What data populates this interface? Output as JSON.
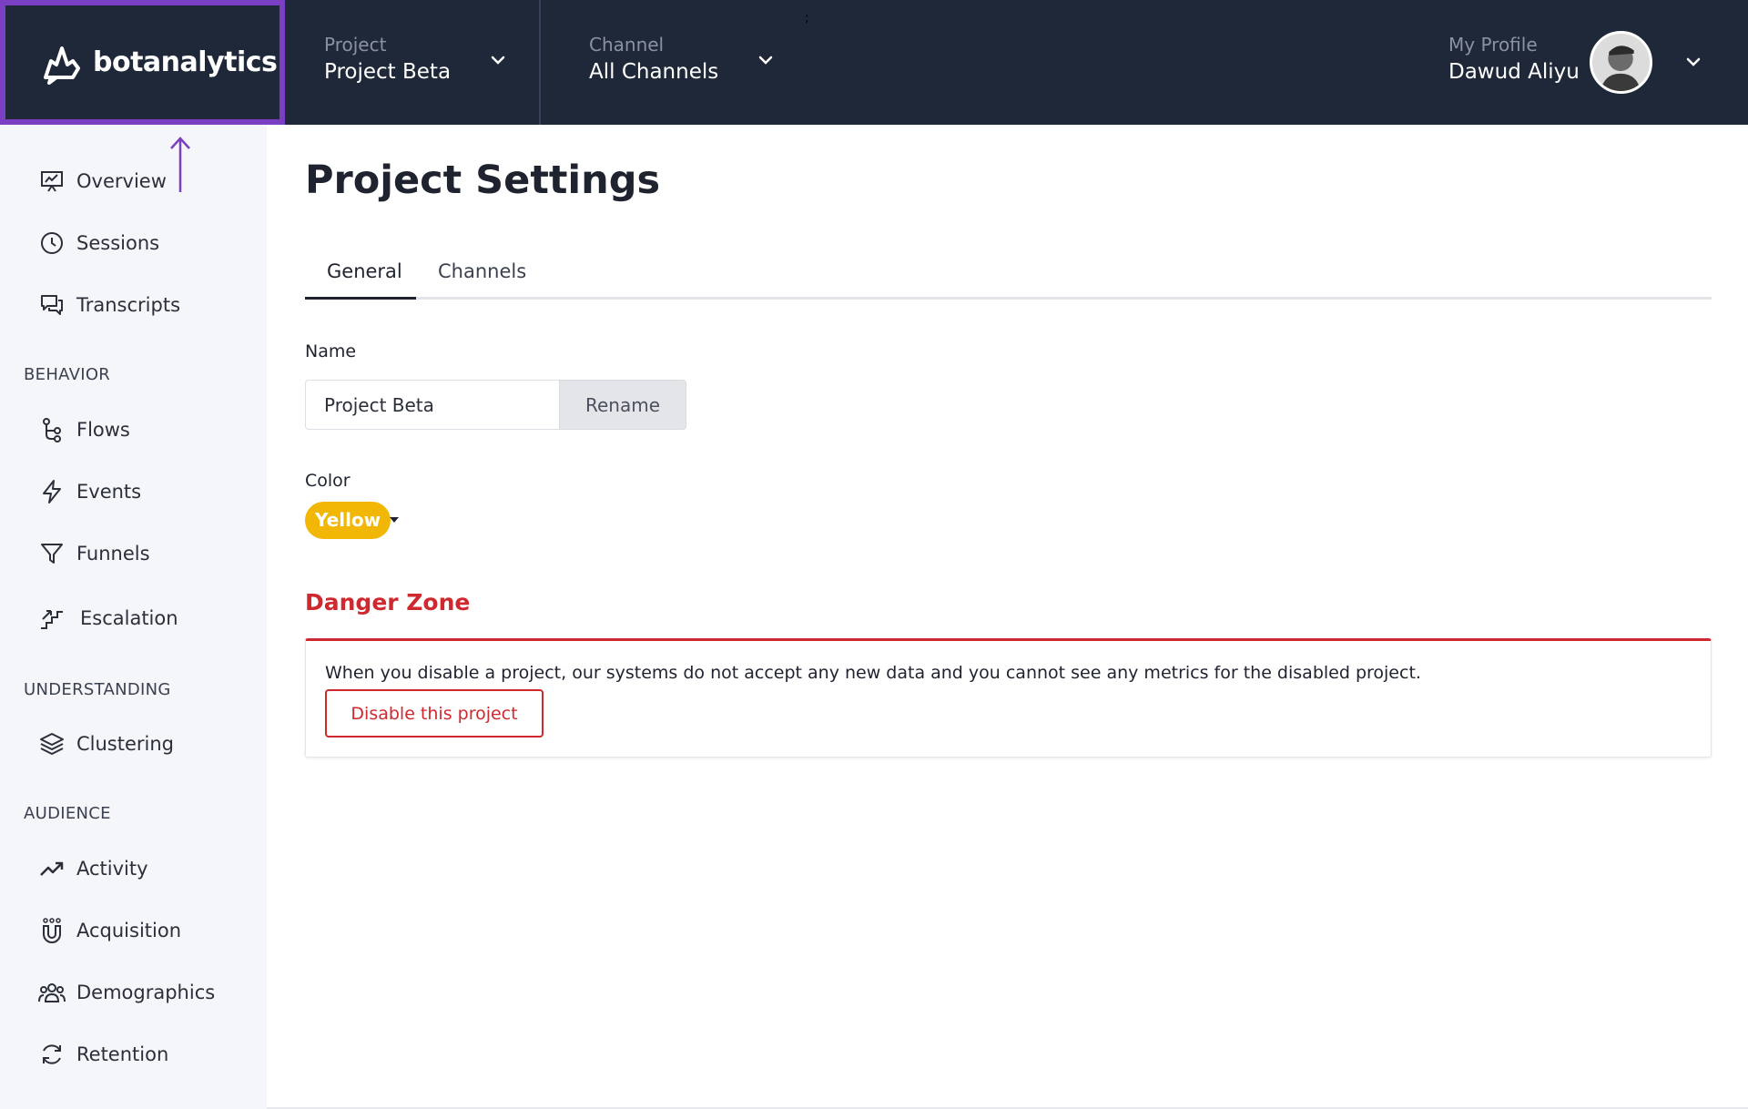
{
  "brand": {
    "name": "botanalytics"
  },
  "header": {
    "project": {
      "label": "Project",
      "value": "Project Beta"
    },
    "channel": {
      "label": "Channel",
      "value": "All Channels"
    },
    "profile": {
      "label": "My Profile",
      "name": "Dawud Aliyu"
    }
  },
  "sidebar": {
    "items": [
      {
        "label": "Overview",
        "icon": "presentation-chart-icon"
      },
      {
        "label": "Sessions",
        "icon": "clock-icon"
      },
      {
        "label": "Transcripts",
        "icon": "chat-bubbles-icon"
      }
    ],
    "sections": [
      {
        "title": "BEHAVIOR",
        "items": [
          {
            "label": "Flows",
            "icon": "flow-branch-icon"
          },
          {
            "label": "Events",
            "icon": "lightning-icon"
          },
          {
            "label": "Funnels",
            "icon": "funnel-icon"
          },
          {
            "label": "Escalation",
            "icon": "stairs-icon"
          }
        ]
      },
      {
        "title": "UNDERSTANDING",
        "items": [
          {
            "label": "Clustering",
            "icon": "layers-icon"
          }
        ]
      },
      {
        "title": "AUDIENCE",
        "items": [
          {
            "label": "Activity",
            "icon": "trending-up-icon"
          },
          {
            "label": "Acquisition",
            "icon": "magnet-icon"
          },
          {
            "label": "Demographics",
            "icon": "users-icon"
          },
          {
            "label": "Retention",
            "icon": "refresh-icon"
          }
        ]
      }
    ]
  },
  "main": {
    "title": "Project Settings",
    "tabs": [
      {
        "label": "General",
        "active": true
      },
      {
        "label": "Channels",
        "active": false
      }
    ],
    "name_field": {
      "label": "Name",
      "value": "Project Beta",
      "button": "Rename"
    },
    "color_field": {
      "label": "Color",
      "value": "Yellow",
      "color": "#f2b705"
    },
    "danger_zone": {
      "title": "Danger Zone",
      "text": "When you disable a project, our systems do not accept any new data and you cannot see any metrics for the disabled project.",
      "button": "Disable this project",
      "color": "#d0282f"
    }
  },
  "colors": {
    "topbar": "#1f2838",
    "annotation": "#7a3fc2",
    "sidebar": "#f5f6fa"
  }
}
